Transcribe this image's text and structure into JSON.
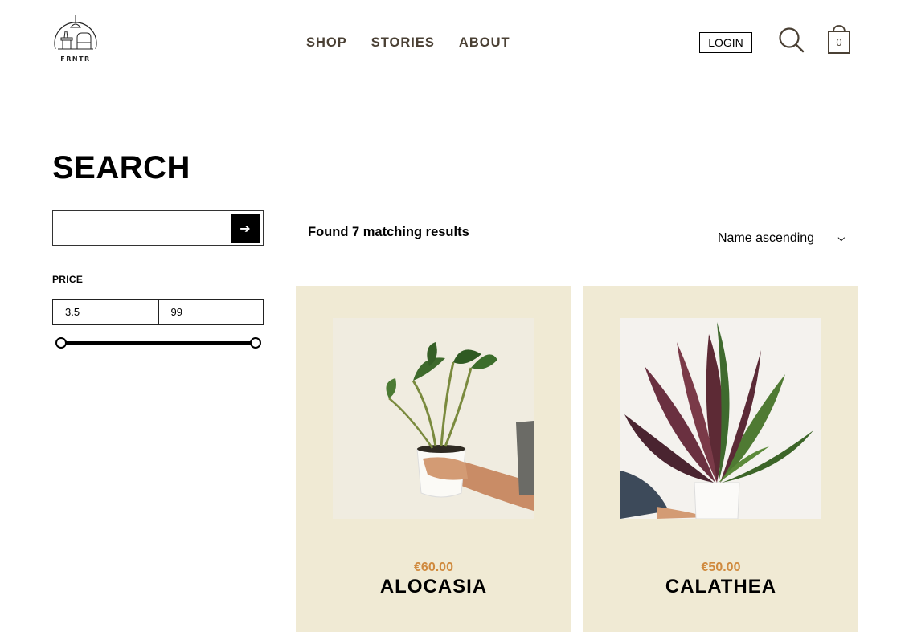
{
  "brand": {
    "logo_text": "FRNTR",
    "logo_icon": "chair-lamp-logo"
  },
  "nav": {
    "items": [
      {
        "label": "SHOP"
      },
      {
        "label": "STORIES"
      },
      {
        "label": "ABOUT"
      }
    ]
  },
  "header": {
    "login_label": "LOGIN",
    "search_icon": "search-icon",
    "cart_icon": "shopping-bag-icon",
    "cart_count": "0"
  },
  "search": {
    "title": "SEARCH",
    "query": "",
    "submit_icon": "arrow-right-icon",
    "submit_glyph": "➔"
  },
  "filters": {
    "price_label": "PRICE",
    "price_min": "3.5",
    "price_max": "99",
    "slider_min_fraction": 0,
    "slider_max_fraction": 1
  },
  "results": {
    "count_text": "Found 7 matching results",
    "sort_value": "Name ascending",
    "sort_icon": "chevron-down-icon"
  },
  "products": [
    {
      "price": "€60.00",
      "name": "ALOCASIA"
    },
    {
      "price": "€50.00",
      "name": "CALATHEA"
    }
  ],
  "colors": {
    "card_bg": "#f0ead4",
    "price": "#d08a3e",
    "nav_text": "#4a4034"
  }
}
